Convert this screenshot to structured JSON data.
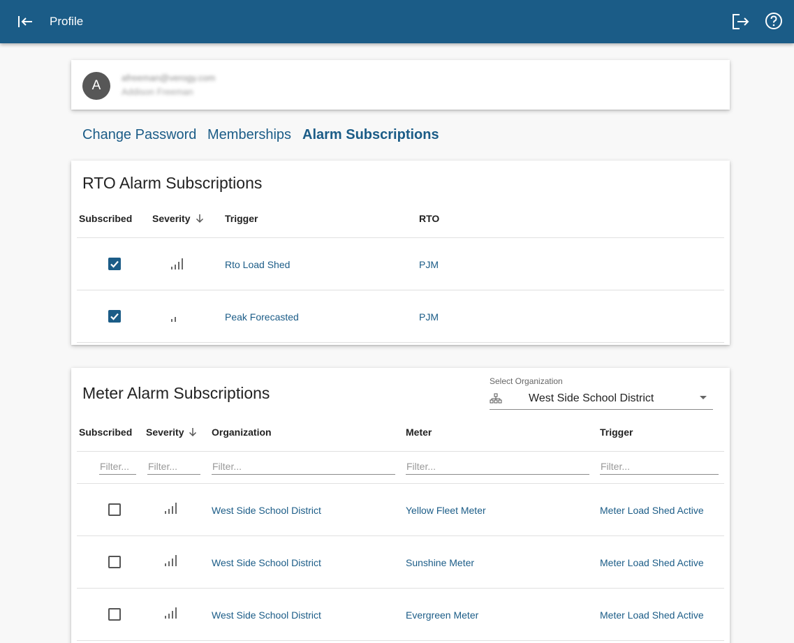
{
  "header": {
    "title": "Profile",
    "back_icon": "collapse-left-icon",
    "logout_icon": "logout-icon",
    "help_icon": "help-icon"
  },
  "profile": {
    "initial": "A",
    "email": "afreeman@verogy.com",
    "name": "Addison Freeman"
  },
  "tabs": [
    {
      "label": "Change Password",
      "active": false
    },
    {
      "label": "Memberships",
      "active": false
    },
    {
      "label": "Alarm Subscriptions",
      "active": true
    }
  ],
  "rto_section": {
    "title": "RTO Alarm Subscriptions",
    "columns": [
      "Subscribed",
      "Severity",
      "Trigger",
      "RTO"
    ],
    "rows": [
      {
        "subscribed": true,
        "severity": 4,
        "trigger": "Rto Load Shed",
        "rto": "PJM"
      },
      {
        "subscribed": true,
        "severity": 2,
        "trigger": "Peak Forecasted",
        "rto": "PJM"
      }
    ]
  },
  "meter_section": {
    "title": "Meter Alarm Subscriptions",
    "select_label": "Select Organization",
    "selected_org": "West Side School District",
    "columns": [
      "Subscribed",
      "Severity",
      "Organization",
      "Meter",
      "Trigger"
    ],
    "filter_placeholder": "Filter...",
    "rows": [
      {
        "subscribed": false,
        "severity": 4,
        "organization": "West Side School District",
        "meter": "Yellow Fleet Meter",
        "trigger": "Meter Load Shed Active"
      },
      {
        "subscribed": false,
        "severity": 4,
        "organization": "West Side School District",
        "meter": "Sunshine Meter",
        "trigger": "Meter Load Shed Active"
      },
      {
        "subscribed": false,
        "severity": 4,
        "organization": "West Side School District",
        "meter": "Evergreen Meter",
        "trigger": "Meter Load Shed Active"
      }
    ]
  },
  "colors": {
    "primary": "#1b5c87",
    "background": "#f8f8f8",
    "card": "#ffffff"
  }
}
